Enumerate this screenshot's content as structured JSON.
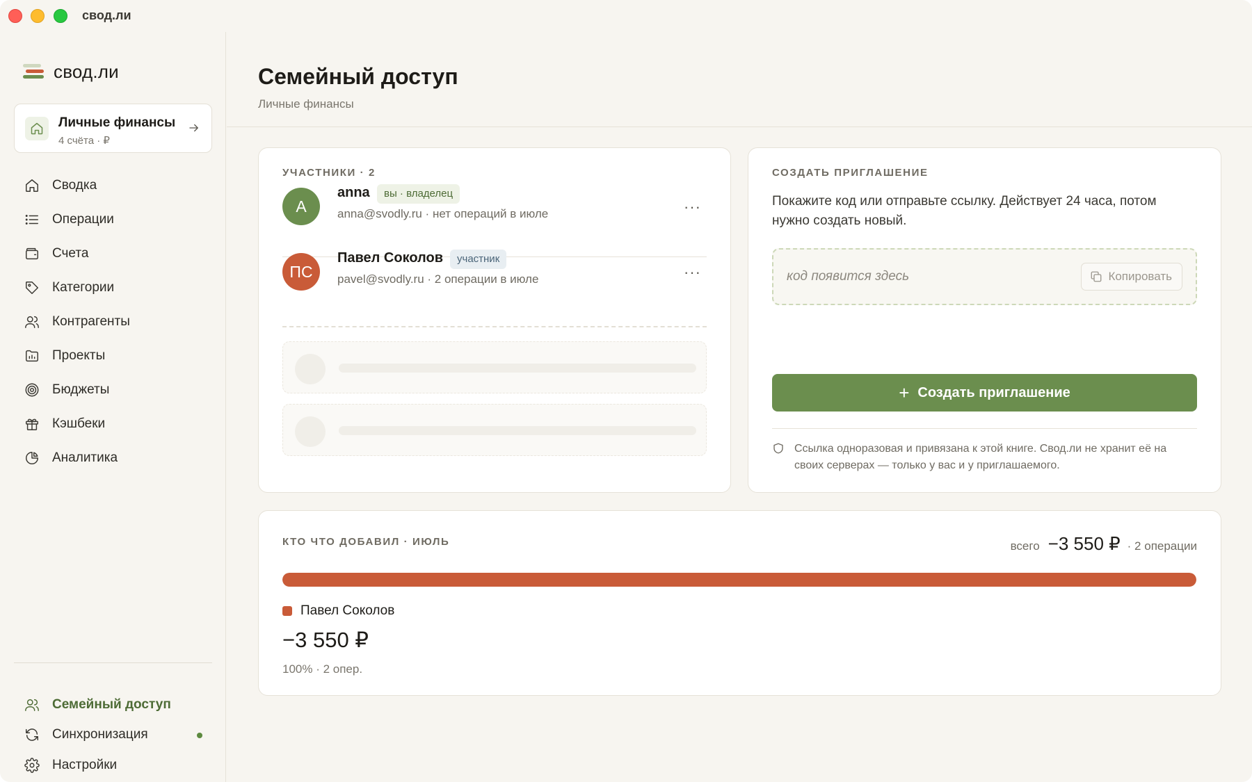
{
  "window": {
    "title": "свод.ли"
  },
  "sidebar": {
    "brand": "свод.ли",
    "book": {
      "title": "Личные финансы",
      "subtitle": "4 счёта · ₽"
    },
    "items": [
      {
        "label": "Сводка",
        "icon": "home-icon"
      },
      {
        "label": "Операции",
        "icon": "list-icon"
      },
      {
        "label": "Счета",
        "icon": "wallet-icon"
      },
      {
        "label": "Категории",
        "icon": "tag-icon"
      },
      {
        "label": "Контрагенты",
        "icon": "users-icon"
      },
      {
        "label": "Проекты",
        "icon": "folder-chart-icon"
      },
      {
        "label": "Бюджеты",
        "icon": "target-icon"
      },
      {
        "label": "Кэшбеки",
        "icon": "gift-icon"
      },
      {
        "label": "Аналитика",
        "icon": "pie-chart-icon"
      }
    ],
    "bottom_items": [
      {
        "label": "Семейный доступ",
        "icon": "users-icon",
        "active": true
      },
      {
        "label": "Синхронизация",
        "icon": "sync-icon",
        "status": "online"
      },
      {
        "label": "Настройки",
        "icon": "gear-icon"
      }
    ]
  },
  "page": {
    "title": "Семейный доступ",
    "subtitle": "Личные финансы"
  },
  "members": {
    "label": "УЧАСТНИКИ · 2",
    "list": [
      {
        "initials": "A",
        "name": "anna",
        "badge": "вы · владелец",
        "subtitle": "anna@svodly.ru · нет операций в июле",
        "avatar_color": "#6b8e4e"
      },
      {
        "initials": "ПС",
        "name": "Павел Соколов",
        "badge": "участник",
        "subtitle": "pavel@svodly.ru · 2 операции в июле",
        "avatar_color": "#c95b38"
      }
    ],
    "more_label": "···"
  },
  "invite": {
    "label": "СОЗДАТЬ ПРИГЛАШЕНИЕ",
    "description": "Покажите код или отправьте ссылку. Действует 24 часа, потом нужно создать новый.",
    "code_placeholder": "код появится здесь",
    "copy_label": "Копировать",
    "create_label": "Создать приглашение",
    "note": "Ссылка одноразовая и привязана к этой книге. Свод.ли не хранит её на своих серверах — только у вас и у приглашаемого."
  },
  "contributions": {
    "label": "КТО ЧТО ДОБАВИЛ · ИЮЛЬ",
    "total_label": "всего",
    "total_value": "−3 550 ₽",
    "total_ops": "· 2 операции",
    "shares": [
      {
        "name": "Павел Соколов",
        "share": 1.0,
        "color": "#c95b38",
        "amount": "−3 550 ₽",
        "meta": "100% · 2 опер."
      }
    ]
  },
  "colors": {
    "accent": "#6b8e4e",
    "accent_text": "#4d6b35",
    "owner_badge_bg": "#eef2e6",
    "member_badge_bg": "#e8eef2",
    "member_badge_text": "#4a6478"
  }
}
